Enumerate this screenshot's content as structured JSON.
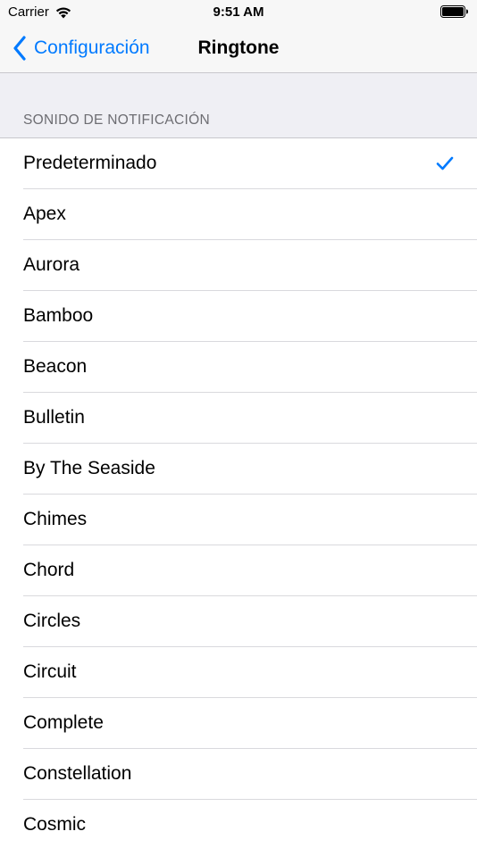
{
  "status_bar": {
    "carrier": "Carrier",
    "time": "9:51 AM"
  },
  "nav": {
    "back_label": "Configuración",
    "title": "Ringtone"
  },
  "section": {
    "header": "SONIDO DE NOTIFICACIÓN"
  },
  "items": [
    {
      "label": "Predeterminado",
      "selected": true
    },
    {
      "label": "Apex",
      "selected": false
    },
    {
      "label": "Aurora",
      "selected": false
    },
    {
      "label": "Bamboo",
      "selected": false
    },
    {
      "label": "Beacon",
      "selected": false
    },
    {
      "label": "Bulletin",
      "selected": false
    },
    {
      "label": "By The Seaside",
      "selected": false
    },
    {
      "label": "Chimes",
      "selected": false
    },
    {
      "label": "Chord",
      "selected": false
    },
    {
      "label": "Circles",
      "selected": false
    },
    {
      "label": "Circuit",
      "selected": false
    },
    {
      "label": "Complete",
      "selected": false
    },
    {
      "label": "Constellation",
      "selected": false
    },
    {
      "label": "Cosmic",
      "selected": false
    }
  ],
  "colors": {
    "accent": "#007aff",
    "background": "#efeff4",
    "separator": "#c8c7cc"
  },
  "icons": {
    "wifi": "wifi-icon",
    "battery": "battery-icon",
    "back": "chevron-left-icon",
    "selected": "checkmark-icon"
  }
}
